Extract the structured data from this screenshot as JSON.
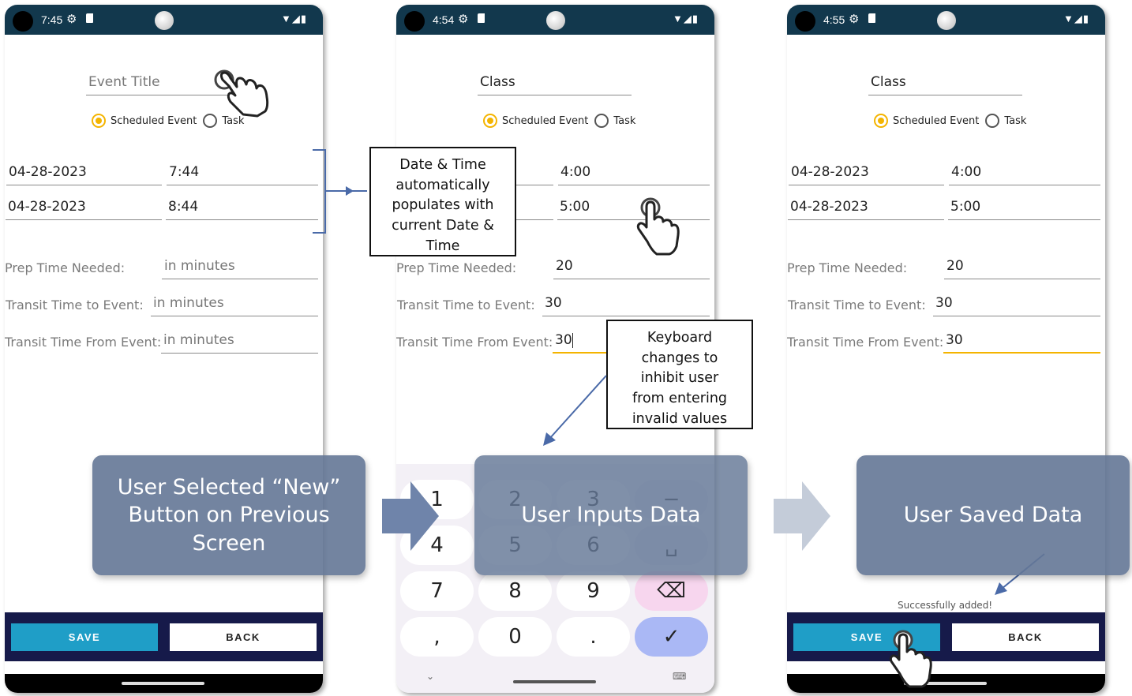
{
  "screens": [
    {
      "status_time": "7:45",
      "title_value": "Event Title",
      "radio_scheduled": "Scheduled Event",
      "radio_task": "Task",
      "start_date": "04-28-2023",
      "start_time": "7:44",
      "end_date": "04-28-2023",
      "end_time": "8:44",
      "prep_label": "Prep Time Needed:",
      "prep_value": "in minutes",
      "transit_to_label": "Transit Time to Event:",
      "transit_to_value": "in minutes",
      "transit_from_label": "Transit Time From Event:",
      "transit_from_value": "in minutes",
      "save_label": "SAVE",
      "back_label": "BACK"
    },
    {
      "status_time": "4:54",
      "title_value": "Class",
      "radio_scheduled": "Scheduled Event",
      "radio_task": "Task",
      "start_time": "4:00",
      "end_time": "5:00",
      "prep_label": "Prep Time Needed:",
      "prep_value": "20",
      "transit_to_label": "Transit Time to Event:",
      "transit_to_value": "30",
      "transit_from_label": "Transit Time From Event:",
      "transit_from_value": "30",
      "keys": [
        "1",
        "2",
        "3",
        "−",
        "4",
        "5",
        "6",
        "␣",
        "7",
        "8",
        "9",
        "⌫",
        ",",
        "0",
        ".",
        "✓"
      ]
    },
    {
      "status_time": "4:55",
      "title_value": "Class",
      "radio_scheduled": "Scheduled Event",
      "radio_task": "Task",
      "start_date": "04-28-2023",
      "start_time": "4:00",
      "end_date": "04-28-2023",
      "end_time": "5:00",
      "prep_label": "Prep Time Needed:",
      "prep_value": "20",
      "transit_to_label": "Transit Time to Event:",
      "transit_to_value": "30",
      "transit_from_label": "Transit Time From Event:",
      "transit_from_value": "30",
      "toast": "Successfully added!",
      "save_label": "SAVE",
      "back_label": "BACK"
    }
  ],
  "callouts": {
    "datetime_note": [
      "Date & Time",
      "automatically",
      "populates with",
      "current Date &",
      "Time"
    ],
    "keyboard_note": [
      "Keyboard",
      "changes to",
      "inhibit user",
      "from entering",
      "invalid values"
    ]
  },
  "steps": {
    "step1": [
      "User Selected “New”",
      "Button on Previous",
      "Screen"
    ],
    "step2": "User Inputs Data",
    "step3": "User Saved Data"
  },
  "colors": {
    "statusbar": "#12384d",
    "save_button": "#1f9ec7",
    "bottom_bar": "#161a4a",
    "accent_radio": "#f4b400",
    "overlay": "#647796",
    "arrow_blue": "#4a6aa8"
  },
  "icons": [
    "settings-gear-icon",
    "sd-card-icon",
    "wifi-icon",
    "signal-icon",
    "battery-icon",
    "hand-pointer-icon",
    "step-arrow-icon"
  ]
}
